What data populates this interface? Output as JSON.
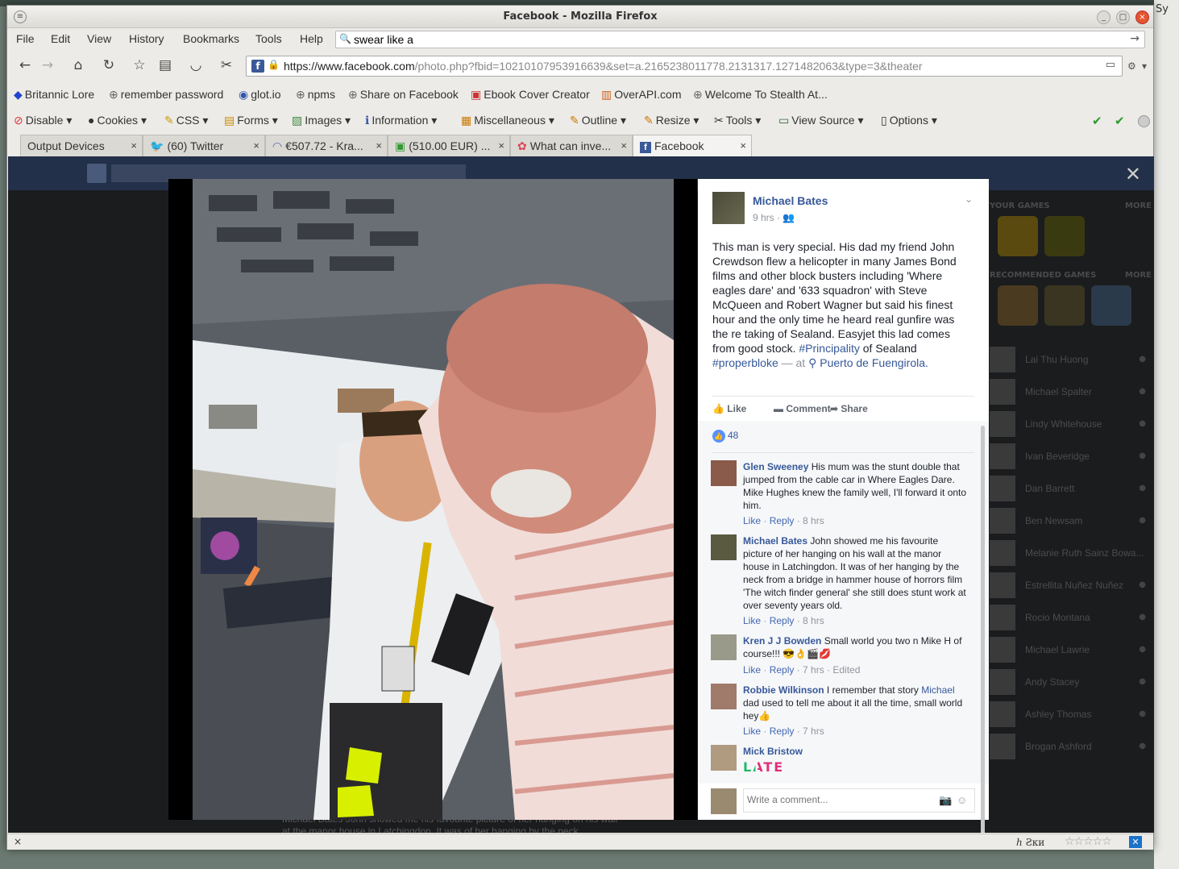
{
  "window": {
    "title": "Facebook - Mozilla Firefox",
    "min_label": "_",
    "max_label": "□",
    "close_label": "×"
  },
  "background_right_text": "Sy",
  "menubar": {
    "items": [
      "File",
      "Edit",
      "View",
      "History",
      "Bookmarks",
      "Tools",
      "Help"
    ],
    "search_value": "swear like a"
  },
  "navbar": {
    "url_domain": "https://www.facebook.com",
    "url_path": "/photo.php?fbid=10210107953916639&set=a.2165238011778.2131317.1271482063&type=3&theater"
  },
  "bookmarks": [
    {
      "label": "Britannic Lore",
      "icon": "◆"
    },
    {
      "label": "remember password",
      "icon": "⊕"
    },
    {
      "label": "glot.io",
      "icon": "◉"
    },
    {
      "label": "npms",
      "icon": "⊕"
    },
    {
      "label": "Share on Facebook",
      "icon": "⊕"
    },
    {
      "label": "Ebook Cover Creator",
      "icon": "▣"
    },
    {
      "label": "OverAPI.com",
      "icon": "▥"
    },
    {
      "label": "Welcome To Stealth At...",
      "icon": "⊕"
    }
  ],
  "devtools": [
    {
      "label": "Disable",
      "icon": "⊘"
    },
    {
      "label": "Cookies",
      "icon": "●"
    },
    {
      "label": "CSS",
      "icon": "✎"
    },
    {
      "label": "Forms",
      "icon": "▤"
    },
    {
      "label": "Images",
      "icon": "▨"
    },
    {
      "label": "Information",
      "icon": "ℹ"
    },
    {
      "label": "Miscellaneous",
      "icon": "▦"
    },
    {
      "label": "Outline",
      "icon": "✎"
    },
    {
      "label": "Resize",
      "icon": "✎"
    },
    {
      "label": "Tools",
      "icon": "✂"
    },
    {
      "label": "View Source",
      "icon": "▭"
    },
    {
      "label": "Options",
      "icon": "▯"
    }
  ],
  "tabs": [
    {
      "label": "Output Devices",
      "icon": ""
    },
    {
      "label": "(60) Twitter",
      "icon": "🐦"
    },
    {
      "label": "€507.72 - Kra...",
      "icon": "◠"
    },
    {
      "label": "(510.00 EUR) ...",
      "icon": "▣"
    },
    {
      "label": "What can inve...",
      "icon": "✿"
    },
    {
      "label": "Facebook",
      "icon": "f"
    }
  ],
  "right_column": {
    "games_header": "YOUR GAMES",
    "rec_header": "RECOMMENDED GAMES",
    "more": "MORE",
    "people": [
      "Lai Thu Huong",
      "Michael Spalter",
      "Lindy Whitehouse",
      "Ivan Beveridge",
      "Dan Barrett",
      "Ben Newsam",
      "Melanie Ruth Sainz Bowa...",
      "Estrellita Nuñez Nuñez",
      "Rocio Montana",
      "Michael Lawrie",
      "Andy Stacey",
      "Ashley Thomas",
      "Brogan Ashford"
    ]
  },
  "behind_text": "Michael Bates John showed me his favourite picture of her hanging on his wall at the manor house in Latchingdon. It was of her hanging by the neck",
  "post": {
    "author": "Michael Bates",
    "time": "9 hrs · ",
    "body_before": "This man is very special. His dad my friend John Crewdson flew a helicopter in many James Bond films and other block busters including 'Where eagles dare' and '633 squadron' with Steve McQueen and Robert Wagner but said his finest hour and the only time he heard real gunfire was the re taking of Sealand. Easyjet this lad comes from good stock. ",
    "hashtag1": "#Principality",
    "body_mid": " of Sealand ",
    "hashtag2": "#properbloke",
    "at_text": " — at ",
    "location": "Puerto de Fuengirola.",
    "actions": {
      "like": "Like",
      "comment": "Comment",
      "share": "Share"
    },
    "like_count": "48"
  },
  "comments": [
    {
      "author": "Glen Sweeney",
      "text": " His mum was the stunt double that jumped from the cable car in Where Eagles Dare. Mike Hughes knew the family well, I'll forward it onto him.",
      "meta_like": "Like",
      "meta_reply": "Reply",
      "meta_time": " · 8 hrs"
    },
    {
      "author": "Michael Bates",
      "text": " John showed me his favourite picture of her hanging on his wall at the manor house in Latchingdon. It was of her hanging by the neck from a bridge in hammer house of horrors film 'The witch finder general' she still does stunt work at over seventy years old.",
      "meta_like": "Like",
      "meta_reply": "Reply",
      "meta_time": " · 8 hrs"
    },
    {
      "author": "Kren J J Bowden",
      "text": " Small world you two n Mike H of course!!! 😎👌🎬💋",
      "meta_like": "Like",
      "meta_reply": "Reply",
      "meta_time": " · 7 hrs · Edited"
    },
    {
      "author": "Robbie Wilkinson",
      "text_before": " I remember that story ",
      "mention": "Michael",
      "text_after": " dad used to tell me about it all the time, small world hey👍",
      "meta_like": "Like",
      "meta_reply": "Reply",
      "meta_time": " · 7 hrs"
    },
    {
      "author": "Mick Bristow",
      "sticker": "LATE"
    }
  ],
  "write_comment_placeholder": "Write a comment...",
  "statusbar": {
    "close": "×",
    "sk_text": "ℎ Ƨки",
    "stars": "☆☆☆☆☆",
    "x_label": "✕"
  }
}
